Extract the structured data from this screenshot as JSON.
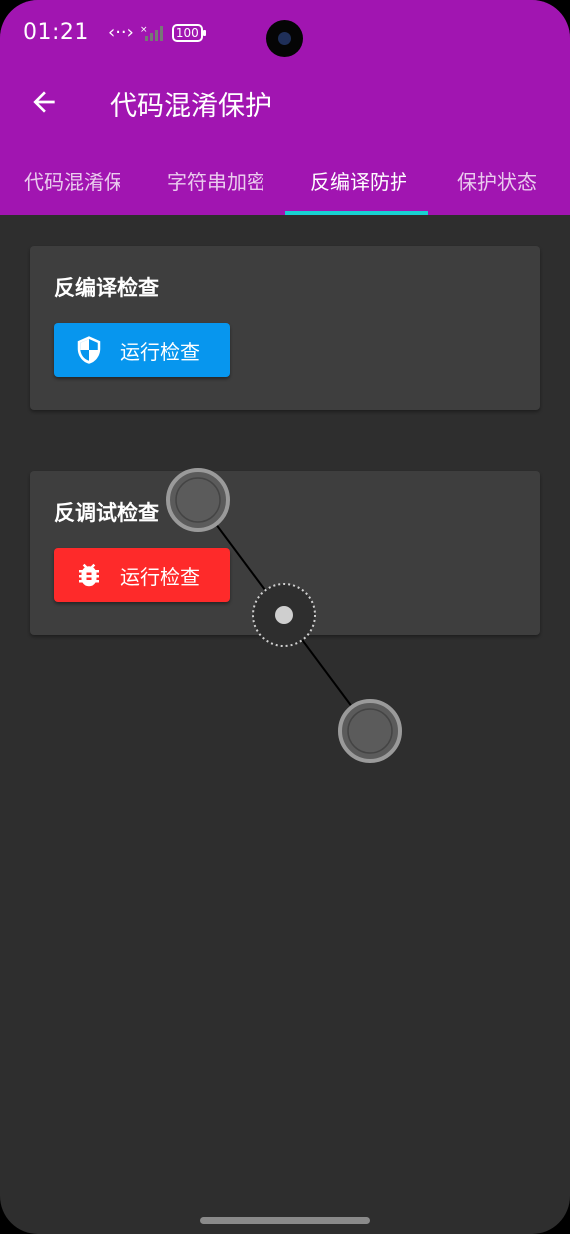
{
  "status_bar": {
    "time": "01:21",
    "battery": "100",
    "icons": [
      "data-transfer-icon",
      "signal-icon",
      "battery-icon"
    ]
  },
  "header": {
    "title": "代码混淆保护",
    "background": "#a115b1"
  },
  "tabs": [
    {
      "label": "代码混淆保护",
      "active": false
    },
    {
      "label": "字符串加密",
      "active": false
    },
    {
      "label": "反编译防护",
      "active": true
    },
    {
      "label": "保护状态",
      "active": false
    }
  ],
  "indicator_color": "#19d1d1",
  "cards": [
    {
      "title": "反编译检查",
      "button_label": "运行检查",
      "button_color": "#0796ee",
      "button_icon": "shield-icon"
    },
    {
      "title": "反调试检查",
      "button_label": "运行检查",
      "button_color": "#fe2a2a",
      "button_icon": "bug-icon"
    }
  ]
}
